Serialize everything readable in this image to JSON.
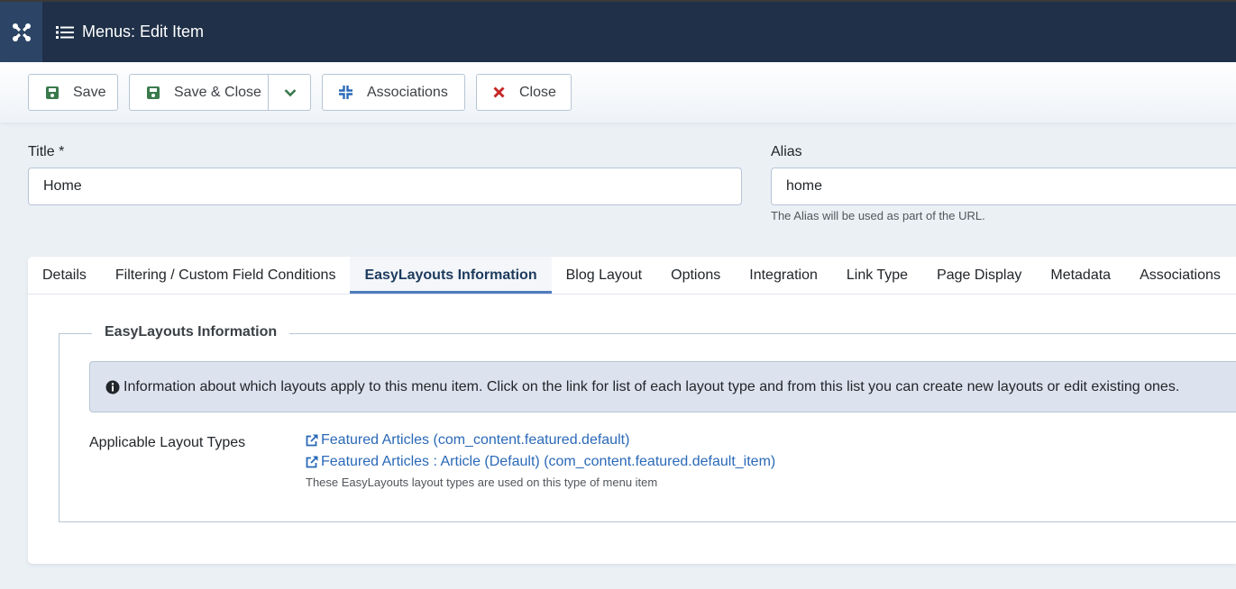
{
  "header": {
    "logo_icon": "joomla-logo-icon",
    "title_icon": "list-icon",
    "title": "Menus: Edit Item"
  },
  "toolbar": {
    "save_label": "Save",
    "save_close_label": "Save & Close",
    "associations_label": "Associations",
    "close_label": "Close"
  },
  "form": {
    "title_label": "Title *",
    "title_value": "Home",
    "alias_label": "Alias",
    "alias_value": "home",
    "alias_hint": "The Alias will be used as part of the URL."
  },
  "tabs": [
    {
      "label": "Details",
      "active": false
    },
    {
      "label": "Filtering / Custom Field Conditions",
      "active": false
    },
    {
      "label": "EasyLayouts Information",
      "active": true
    },
    {
      "label": "Blog Layout",
      "active": false
    },
    {
      "label": "Options",
      "active": false
    },
    {
      "label": "Integration",
      "active": false
    },
    {
      "label": "Link Type",
      "active": false
    },
    {
      "label": "Page Display",
      "active": false
    },
    {
      "label": "Metadata",
      "active": false
    },
    {
      "label": "Associations",
      "active": false
    }
  ],
  "panel": {
    "legend": "EasyLayouts Information",
    "info_text": "Information about which layouts apply to this menu item. Click on the link for list of each layout type and from this list you can create new layouts or edit existing ones.",
    "row_label": "Applicable Layout Types",
    "links": [
      "Featured Articles (com_content.featured.default)",
      "Featured Articles : Article (Default) (com_content.featured.default_item)"
    ],
    "description": "These EasyLayouts layout types are used on this type of menu item"
  },
  "colors": {
    "header_bg": "#1f3048",
    "accent": "#4f7bbd",
    "link": "#2a69b8",
    "save_icon": "#3a7a4c",
    "close_icon": "#c52827"
  }
}
